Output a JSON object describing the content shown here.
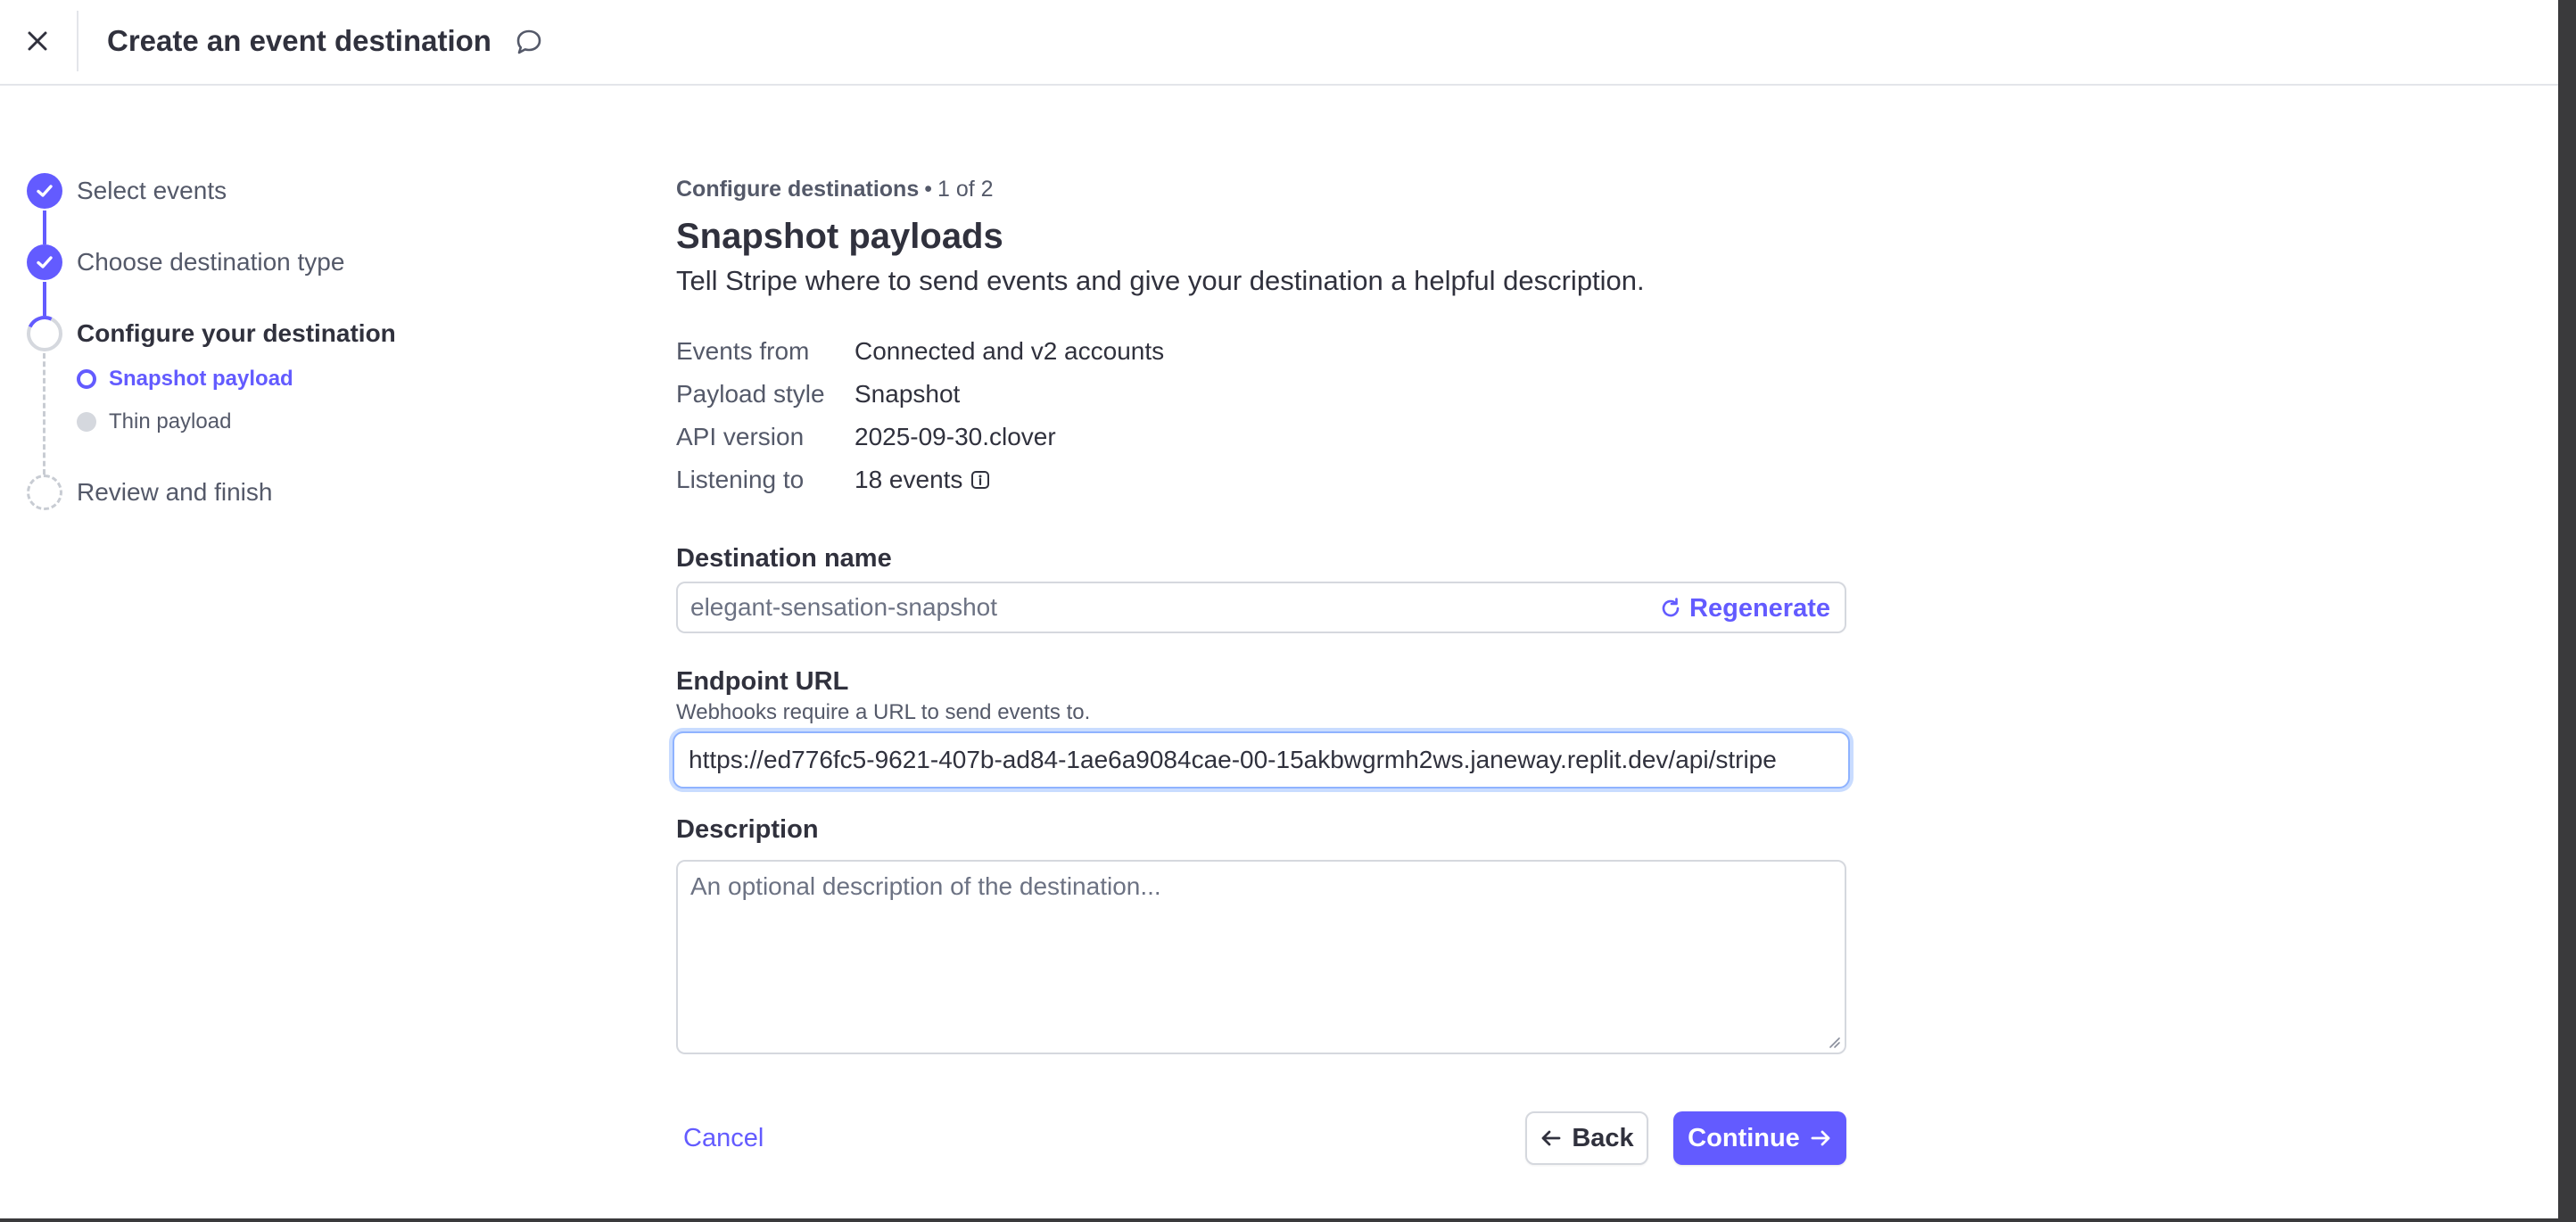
{
  "header": {
    "title": "Create an event destination",
    "close_icon": "close-icon",
    "feedback_icon": "speech-bubble-icon"
  },
  "stepper": {
    "steps": [
      {
        "label": "Select events",
        "status": "complete"
      },
      {
        "label": "Choose destination type",
        "status": "complete"
      },
      {
        "label": "Configure your destination",
        "status": "current"
      },
      {
        "label": "Review and finish",
        "status": "upcoming"
      }
    ],
    "substeps": [
      {
        "label": "Snapshot payload",
        "status": "current"
      },
      {
        "label": "Thin payload",
        "status": "upcoming"
      }
    ]
  },
  "main": {
    "breadcrumb_section": "Configure destinations",
    "breadcrumb_separator": "•",
    "breadcrumb_count": "1 of 2",
    "title": "Snapshot payloads",
    "subtitle": "Tell Stripe where to send events and give your destination a helpful description.",
    "details": [
      {
        "label": "Events from",
        "value": "Connected and v2 accounts"
      },
      {
        "label": "Payload style",
        "value": "Snapshot"
      },
      {
        "label": "API version",
        "value": "2025-09-30.clover"
      },
      {
        "label": "Listening to",
        "value": "18 events"
      }
    ],
    "destination_name": {
      "label": "Destination name",
      "placeholder": "elegant-sensation-snapshot",
      "regenerate_label": "Regenerate"
    },
    "endpoint_url": {
      "label": "Endpoint URL",
      "help": "Webhooks require a URL to send events to.",
      "value": "https://ed776fc5-9621-407b-ad84-1ae6a9084cae-00-15akbwgrmh2ws.janeway.replit.dev/api/stripe"
    },
    "description": {
      "label": "Description",
      "placeholder": "An optional description of the destination..."
    }
  },
  "footer": {
    "cancel_label": "Cancel",
    "back_label": "Back",
    "continue_label": "Continue"
  },
  "colors": {
    "accent": "#635bff",
    "text": "#30313d",
    "muted": "#545969",
    "border": "#d5d8de",
    "focus_ring": "#8fb3ff"
  }
}
